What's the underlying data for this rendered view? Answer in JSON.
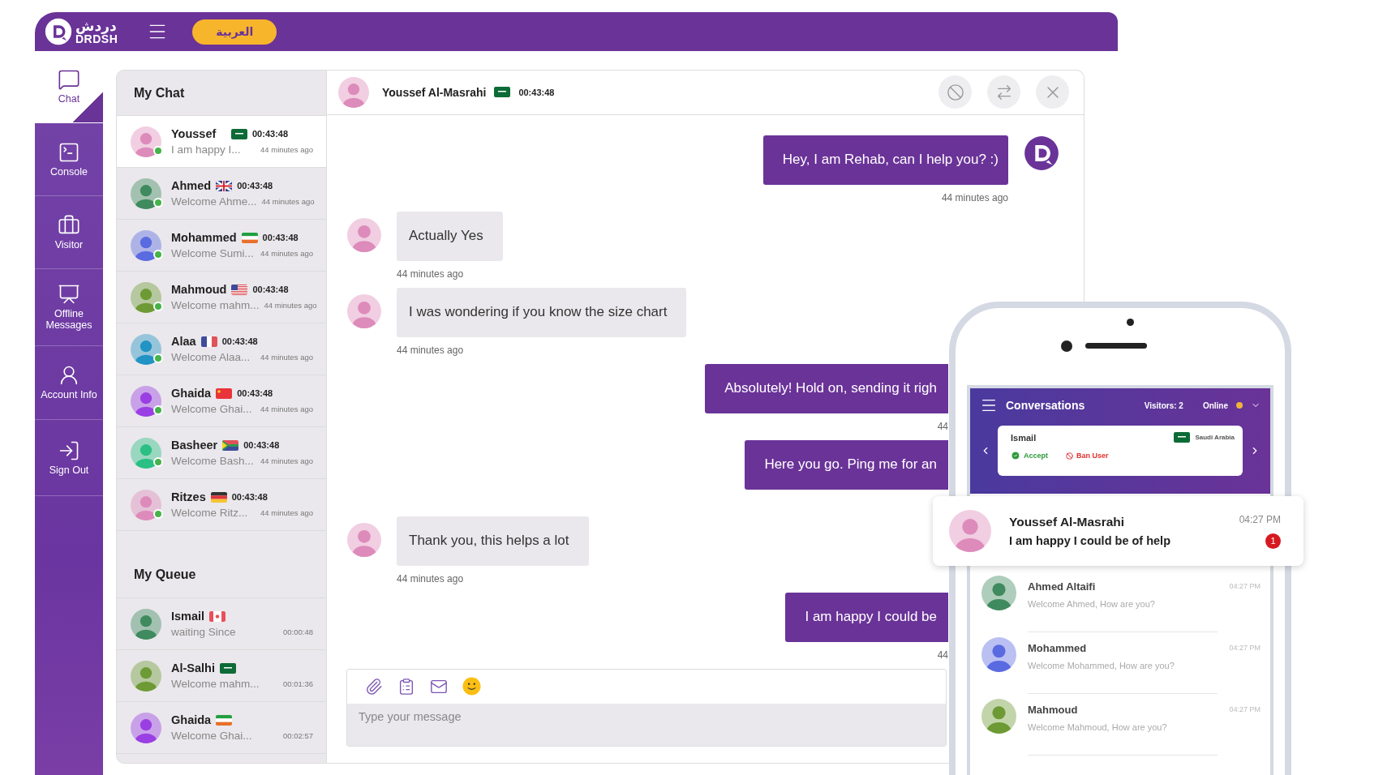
{
  "top_bar": {
    "logo_arabic": "دردش",
    "logo_latin": "DRDSH",
    "language_button": "العربية"
  },
  "sidebar": {
    "items": [
      {
        "kind": "chat",
        "label": "Chat",
        "selected": true
      },
      {
        "kind": "console",
        "label": "Console",
        "selected": false
      },
      {
        "kind": "visitor",
        "label": "Visitor",
        "selected": false
      },
      {
        "kind": "offline",
        "label": "Offline Messages",
        "selected": false
      },
      {
        "kind": "account",
        "label": "Account Info",
        "selected": false
      },
      {
        "kind": "signout",
        "label": "Sign Out",
        "selected": false
      }
    ]
  },
  "my_chat": {
    "title": "My Chat",
    "items": [
      {
        "name": "Youssef",
        "flag": {
          "kind": "sa"
        },
        "time": "00:43:48",
        "preview": "I am happy I...",
        "ago": "44 minutes ago",
        "color": "#dd8bbb",
        "online": true,
        "selected": true
      },
      {
        "name": "Ahmed",
        "flag": {
          "kind": "gb"
        },
        "time": "00:43:48",
        "preview": "Welcome Ahme...",
        "ago": "44 minutes ago",
        "color": "#3f8a5e",
        "online": true,
        "selected": false
      },
      {
        "name": "Mohammed",
        "flag": {
          "kind": "ir"
        },
        "time": "00:43:48",
        "preview": "Welcome Sumi...",
        "ago": "44 minutes ago",
        "color": "#5a6ae0",
        "online": true,
        "selected": false
      },
      {
        "name": "Mahmoud",
        "flag": {
          "kind": "us"
        },
        "time": "00:43:48",
        "preview": "Welcome mahm...",
        "ago": "44 minutes ago",
        "color": "#6d9a34",
        "online": true,
        "selected": false
      },
      {
        "name": "Alaa",
        "flag": {
          "kind": "fr"
        },
        "time": "00:43:48",
        "preview": "Welcome Alaa...",
        "ago": "44 minutes ago",
        "color": "#2193c4",
        "online": true,
        "selected": false
      },
      {
        "name": "Ghaida",
        "flag": {
          "kind": "cn"
        },
        "time": "00:43:48",
        "preview": "Welcome Ghai...",
        "ago": "44 minutes ago",
        "color": "#9a3fe3",
        "online": true,
        "selected": false
      },
      {
        "name": "Basheer",
        "flag": {
          "kind": "za"
        },
        "time": "00:43:48",
        "preview": "Welcome Bash...",
        "ago": "44 minutes ago",
        "color": "#2bbf84",
        "online": true,
        "selected": false
      },
      {
        "name": "Ritzes",
        "flag": {
          "kind": "de"
        },
        "time": "00:43:48",
        "preview": "Welcome Ritz...",
        "ago": "44 minutes ago",
        "color": "#dd8bbb",
        "online": true,
        "selected": false
      }
    ]
  },
  "my_queue": {
    "title": "My Queue",
    "items": [
      {
        "name": "Ismail",
        "flag": {
          "kind": "ca"
        },
        "preview": "waiting Since",
        "wait": "00:00:48",
        "color": "#3f8a5e"
      },
      {
        "name": "Al-Salhi",
        "flag": {
          "kind": "sa"
        },
        "preview": "Welcome mahm...",
        "wait": "00:01:36",
        "color": "#6d9a34"
      },
      {
        "name": "Ghaida",
        "flag": {
          "kind": "ir"
        },
        "preview": "Welcome Ghai...",
        "wait": "00:02:57",
        "color": "#9a3fe3"
      }
    ]
  },
  "conversation": {
    "name": "Youssef Al-Masrahi",
    "flag": {
      "kind": "sa"
    },
    "time": "00:43:48",
    "color": "#dd8bbb",
    "messages": [
      {
        "kind": "sent",
        "text": "Hey, I am Rehab, can I help you? :)",
        "time": "44 minutes ago"
      },
      {
        "kind": "received",
        "text": "Actually Yes",
        "time": "44 minutes ago"
      },
      {
        "kind": "received",
        "text": "I was wondering if you know the size chart",
        "time": "44 minutes ago"
      },
      {
        "kind": "sent_cut",
        "text": "Absolutely! Hold on, sending it righ",
        "time": "44"
      },
      {
        "kind": "sent_cut",
        "text": "Here you go. Ping me for an"
      },
      {
        "kind": "received",
        "text": "Thank you, this helps a lot",
        "time": "44 minutes ago"
      },
      {
        "kind": "sent_cut",
        "text": "I am happy I could be",
        "time": "44"
      }
    ],
    "composer": {
      "placeholder": "Type your message"
    }
  },
  "phone": {
    "title": "Conversations",
    "visitors": "Visitors: 2",
    "status": "Online",
    "visitor_card": {
      "name": "Ismail",
      "flag": {
        "kind": "sa"
      },
      "country": "Saudi Arabia",
      "accept": "Accept",
      "ban": "Ban User"
    },
    "notification": {
      "name": "Youssef Al-Masrahi",
      "message": "I am happy I could be of help",
      "time": "04:27 PM",
      "badge": "1",
      "color": "#dd8bbb"
    },
    "items": [
      {
        "name": "Ahmed Altaifi",
        "message": "Welcome Ahmed, How are you?",
        "time": "04:27 PM",
        "color": "#3f8a5e"
      },
      {
        "name": "Mohammed",
        "message": "Welcome Mohammed, How are you?",
        "time": "04:27 PM",
        "color": "#5a6ae0"
      },
      {
        "name": "Mahmoud",
        "message": "Welcome Mahmoud, How are you?",
        "time": "04:27 PM",
        "color": "#6d9a34"
      }
    ]
  }
}
